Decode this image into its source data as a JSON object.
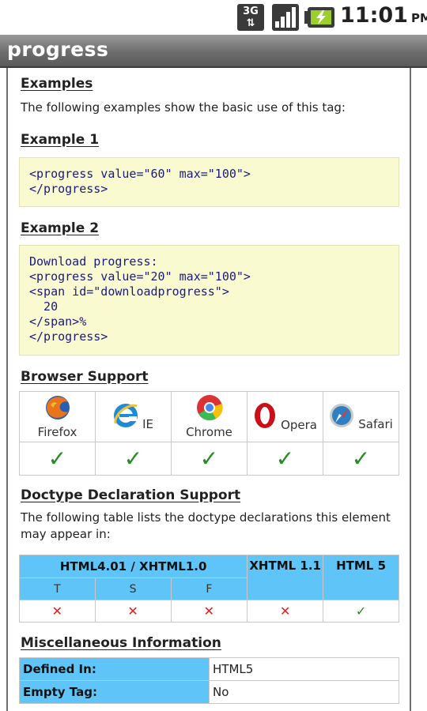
{
  "status_bar": {
    "network": "3G",
    "time": "11:01",
    "ampm": "PM"
  },
  "title_bar": {
    "title": "progress"
  },
  "examples": {
    "heading": "Examples",
    "intro": "The following examples show the basic use of this tag:",
    "example1": {
      "heading": "Example 1",
      "code": "<progress value=\"60\" max=\"100\">\n</progress>"
    },
    "example2": {
      "heading": "Example 2",
      "code": "Download progress:\n<progress value=\"20\" max=\"100\">\n<span id=\"downloadprogress\">\n  20\n</span>%\n</progress>"
    }
  },
  "browser_support": {
    "heading": "Browser Support",
    "browsers": [
      {
        "name": "Firefox",
        "icon": "firefox-icon",
        "supported": "✓"
      },
      {
        "name": "IE",
        "icon": "ie-icon",
        "supported": "✓"
      },
      {
        "name": "Chrome",
        "icon": "chrome-icon",
        "supported": "✓"
      },
      {
        "name": "Opera",
        "icon": "opera-icon",
        "supported": "✓"
      },
      {
        "name": "Safari",
        "icon": "safari-icon",
        "supported": "✓"
      }
    ]
  },
  "doctype": {
    "heading": "Doctype Declaration Support",
    "intro_line1": "The following table lists the doctype declarations this element",
    "intro_line2": "may appear in:",
    "group_header": "HTML4.01 / XHTML1.0",
    "xhtml11": "XHTML 1.1",
    "html5": "HTML 5",
    "sub_t": "T",
    "sub_s": "S",
    "sub_f": "F",
    "values": [
      "✕",
      "✕",
      "✕",
      "✕",
      "✓"
    ]
  },
  "misc": {
    "heading": "Miscellaneous Information",
    "rows": [
      {
        "key": "Defined In:",
        "value": "HTML5"
      },
      {
        "key": "Empty Tag:",
        "value": "No"
      }
    ]
  },
  "colors": {
    "table_header": "#5fc4f7",
    "code_bg": "#fafad0",
    "code_text": "#1a1a80",
    "check_green": "#1e8f1e",
    "cross_red": "#dd2020"
  }
}
